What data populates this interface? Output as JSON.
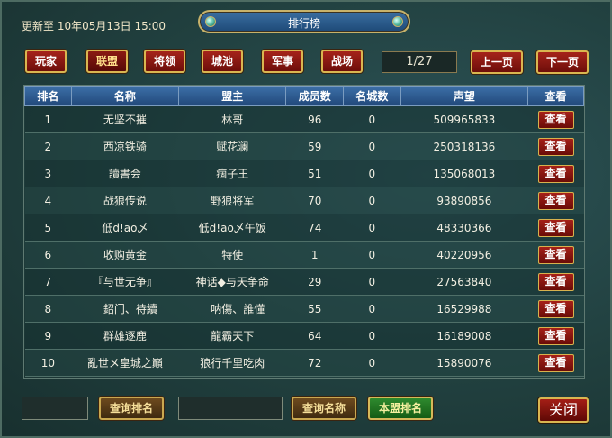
{
  "header": {
    "update_time": "更新至 10年05月13日 15:00",
    "title": "排行榜"
  },
  "categories": [
    "玩家",
    "联盟",
    "将领",
    "城池",
    "军事",
    "战场"
  ],
  "active_category": "联盟",
  "pagination": {
    "indicator": "1/27",
    "prev_label": "上一页",
    "next_label": "下一页"
  },
  "table": {
    "columns": [
      "排名",
      "名称",
      "盟主",
      "成员数",
      "名城数",
      "声望",
      "查看"
    ],
    "view_label": "查看",
    "rows": [
      [
        "1",
        "无坚不摧",
        "林哥",
        "96",
        "0",
        "509965833"
      ],
      [
        "2",
        "西凉铁骑",
        "赋花澜",
        "59",
        "0",
        "250318136"
      ],
      [
        "3",
        "讀書会",
        "痼子王",
        "51",
        "0",
        "135068013"
      ],
      [
        "4",
        "战狼传说",
        "野狼将军",
        "70",
        "0",
        "93890856"
      ],
      [
        "5",
        "低d!ao乄",
        "低d!ao乄午饭",
        "74",
        "0",
        "48330366"
      ],
      [
        "6",
        "收购黄金",
        "特使",
        "1",
        "0",
        "40220956"
      ],
      [
        "7",
        "『与世无争』",
        "神话◆与天争命",
        "29",
        "0",
        "27563840"
      ],
      [
        "8",
        "__鉊门、待續",
        "__呐傷、誰懂",
        "55",
        "0",
        "16529988"
      ],
      [
        "9",
        "群雄逐鹿",
        "龍霸天下",
        "64",
        "0",
        "16189008"
      ],
      [
        "10",
        "亂世メ皇城之巔",
        "狼行千里吃肉",
        "72",
        "0",
        "15890076"
      ]
    ]
  },
  "footer": {
    "query_rank_label": "查询排名",
    "query_name_label": "查询名称",
    "my_alliance_label": "本盟排名",
    "close_label": "关闭"
  }
}
